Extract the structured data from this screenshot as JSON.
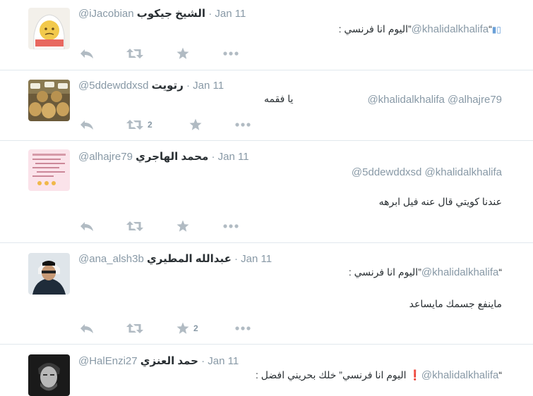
{
  "colors": {
    "icon": "#b1bbc3",
    "muted": "#8899a6",
    "text": "#292f33",
    "divider": "#e1e8ed"
  },
  "tweets": [
    {
      "name": "الشيخ جيكوب",
      "handle": "@iJacobian",
      "date": "Jan 11",
      "lines": [
        {
          "rtl_text": "“",
          "mention": "@khalidalkhalifa",
          "tail": ": اليوم انا فرنسي”"
        }
      ],
      "actions": {
        "reply_icon": "reply-icon",
        "retweet_icon": "retweet-icon",
        "retweet_count": "",
        "favorite_icon": "star-icon",
        "favorite_count": "",
        "more_icon": "more-icon"
      }
    },
    {
      "name": "رتويت",
      "handle": "@5ddewddxsd",
      "date": "Jan 11",
      "mentions": "@khalidalkhalifa @alhajre79",
      "text": "يا فقمه",
      "actions": {
        "retweet_count": "2",
        "favorite_count": ""
      }
    },
    {
      "name": "محمد الهاجري",
      "handle": "@alhajre79",
      "date": "Jan 11",
      "mentions": "@5ddewddxsd @khalidalkhalifa",
      "text": "عندنا كويتي قال عنه فيل ابرهه",
      "actions": {
        "retweet_count": "",
        "favorite_count": ""
      }
    },
    {
      "name": "عبدالله المطيري",
      "handle": "@ana_alsh3b",
      "date": "Jan 11",
      "quote_mention": "@khalidalkhalifa",
      "quote_tail": ": اليوم انا فرنسي”",
      "text": "ماينفع جسمك مايساعد",
      "actions": {
        "retweet_count": "",
        "favorite_count": "2"
      }
    },
    {
      "name": "حمد العنزي",
      "handle": "@HalEnzi27",
      "date": "Jan 11",
      "quote_mention": "@khalidalkhalifa",
      "quote_tail": ": اليوم انا فرنسي” خلك بحريني افضل ❗"
    }
  ],
  "separator": "·",
  "open_quote": "“"
}
